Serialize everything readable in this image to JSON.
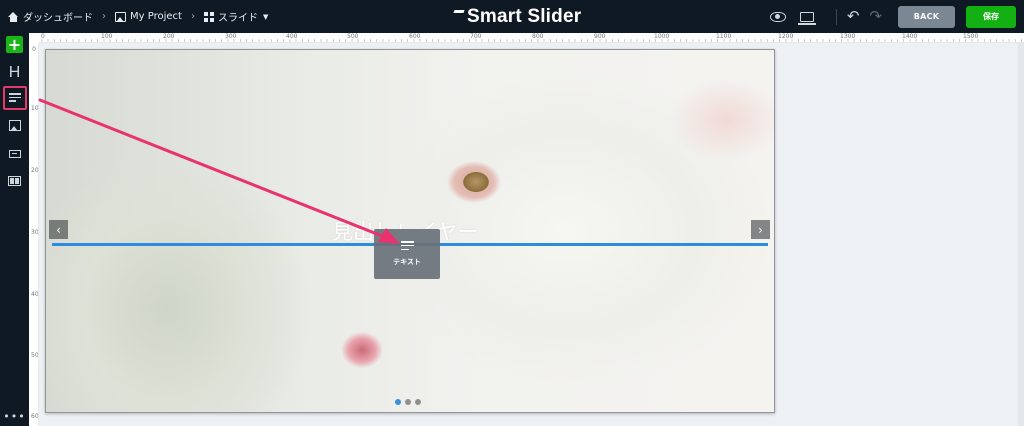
{
  "breadcrumb": {
    "dashboard": "ダッシュボード",
    "project": "My Project",
    "slider": "スライド"
  },
  "app": {
    "logo": "Smart Slider"
  },
  "toolbar": {
    "preview_icon": "eye-icon",
    "device_icon": "laptop-icon",
    "undo_icon": "undo-icon",
    "redo_icon": "redo-icon",
    "back_label": "BACK",
    "save_label": "保存",
    "save_color": "#12b012"
  },
  "sidebar": {
    "items": [
      {
        "name": "add-layer",
        "icon": "plus-icon"
      },
      {
        "name": "heading",
        "label": "H",
        "icon": "heading-icon"
      },
      {
        "name": "text",
        "icon": "text-lines-icon",
        "highlighted": true,
        "highlight_color": "#e23a64"
      },
      {
        "name": "image",
        "icon": "image-icon"
      },
      {
        "name": "button",
        "icon": "button-icon"
      },
      {
        "name": "row",
        "icon": "row-icon"
      }
    ],
    "more_label": "•••"
  },
  "ruler": {
    "top": [
      "0",
      "100",
      "200",
      "300",
      "400",
      "500",
      "600",
      "700",
      "800",
      "900",
      "1000",
      "1100",
      "1200",
      "1300",
      "1400",
      "1500"
    ],
    "left": [
      "0",
      "100",
      "200",
      "300",
      "400",
      "500",
      "600"
    ]
  },
  "slide": {
    "heading_text": "見出しレイヤー",
    "prev_arrow": "‹",
    "next_arrow": "›",
    "bullets": 3,
    "active_bullet": 1,
    "drop_line_color": "#2d8be0"
  },
  "drag_ghost": {
    "label": "テキスト",
    "icon": "text-lines-icon"
  },
  "annotation": {
    "color": "#e8336e"
  }
}
